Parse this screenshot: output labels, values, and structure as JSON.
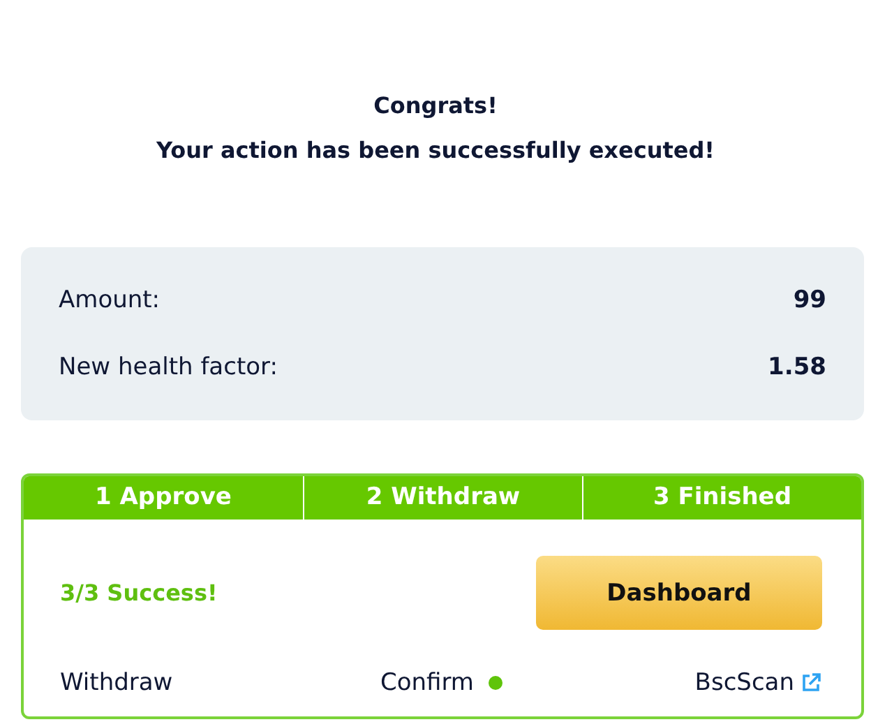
{
  "heading": {
    "title": "Congrats!",
    "message": "Your action has been successfully executed!"
  },
  "details": [
    {
      "label": "Amount:",
      "value": "99"
    },
    {
      "label": "New health factor:",
      "value": "1.58"
    }
  ],
  "steps": [
    {
      "label": "1 Approve",
      "done": true
    },
    {
      "label": "2 Withdraw",
      "done": true
    },
    {
      "label": "3 Finished",
      "done": true
    }
  ],
  "status": "3/3 Success!",
  "button": "Dashboard",
  "footer": {
    "action": "Withdraw",
    "state": "Confirm",
    "confirmed": true,
    "link": "BscScan"
  }
}
